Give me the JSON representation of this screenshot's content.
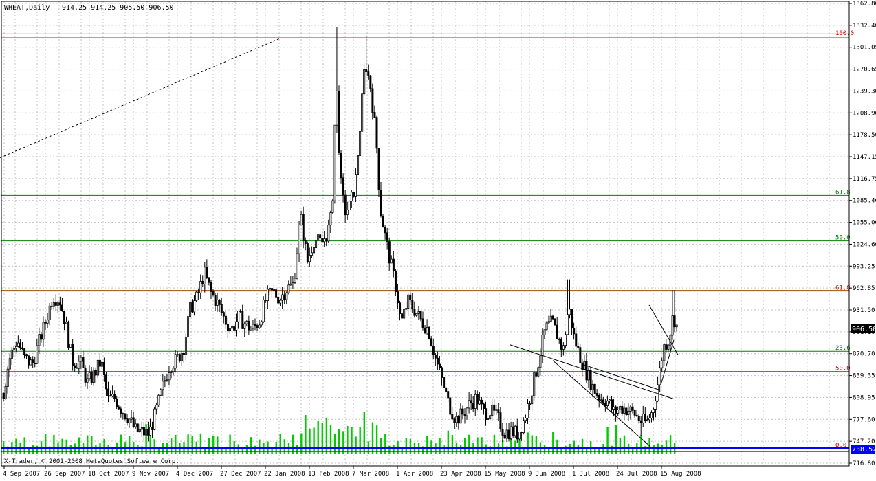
{
  "header": {
    "symbol": "WHEAT,Daily",
    "ohlc": "914.25 914.25 905.50 906.50"
  },
  "footer": {
    "copyright": "X-Trader, © 2001-2008 MetaQuotes Software Corp."
  },
  "colors": {
    "background": "#ffffff",
    "grid": "#c0c0c0",
    "candle": "#000000",
    "volume": "#00cc00",
    "fib_green": "#008000",
    "fib_red": "#d00000",
    "resistance_brown": "#a05000",
    "support_blue": "#0000ff",
    "current_price_bg": "#000000",
    "current_price_fg": "#ffffff",
    "support_label_bg": "#0000ff"
  },
  "chart_data": {
    "type": "candlestick",
    "ylim": [
      716.8,
      1362.8
    ],
    "price_ticks": [
      "1362.80",
      "1332.40",
      "1301.05",
      "1270.65",
      "1239.30",
      "1208.90",
      "1178.50",
      "1147.15",
      "1116.75",
      "1085.40",
      "1055.00",
      "1024.60",
      "993.25",
      "962.85",
      "931.50",
      "901.10",
      "870.70",
      "839.35",
      "808.95",
      "777.60",
      "747.20",
      "716.80"
    ],
    "date_ticks": [
      "4 Sep 2007",
      "26 Sep 2007",
      "18 Oct 2007",
      "9 Nov 2007",
      "4 Dec 2007",
      "27 Dec 2007",
      "22 Jan 2008",
      "13 Feb 2008",
      "7 Mar 2008",
      "1 Apr 2008",
      "23 Apr 2008",
      "15 May 2008",
      "9 Jun 2008",
      "1 Jul 2008",
      "24 Jul 2008",
      "15 Aug 2008"
    ],
    "current_price": "906.50",
    "current_price_value": 906.5,
    "support_price": "738.52",
    "support_price_value": 738.52,
    "fib_levels": [
      {
        "label": "100.0",
        "price": 1316.5,
        "color": "red"
      },
      {
        "label": "61.8",
        "price": 1093.0,
        "color": "green"
      },
      {
        "label": "50.0",
        "price": 1029.0,
        "color": "green"
      },
      {
        "label": "61.8",
        "price": 958.5,
        "color": "red"
      },
      {
        "label": "23.6",
        "price": 874.0,
        "color": "green"
      },
      {
        "label": "50.0",
        "price": 845.5,
        "color": "red"
      },
      {
        "label": "0.0",
        "price": 737.5,
        "color": "red"
      }
    ],
    "horizontal_lines": [
      {
        "name": "top-red",
        "price": 1320.0,
        "color": "red"
      },
      {
        "name": "top-green",
        "price": 1314.5,
        "color": "green"
      },
      {
        "name": "resistance",
        "price": 959.0,
        "color": "brown"
      },
      {
        "name": "support",
        "price": 738.5,
        "color": "blue"
      },
      {
        "name": "bottom-red",
        "price": 733.0,
        "color": "red"
      }
    ],
    "trend_lines": [
      {
        "name": "dotted-trend",
        "style": "dashed",
        "points": [
          [
            0,
            1146
          ],
          [
            408,
            1314
          ]
        ]
      },
      {
        "name": "upper-wedge",
        "style": "solid",
        "points": [
          [
            742,
            883
          ],
          [
            980,
            807
          ]
        ]
      },
      {
        "name": "lower-wedge",
        "style": "solid",
        "points": [
          [
            804,
            861
          ],
          [
            946,
            740
          ]
        ]
      },
      {
        "name": "inner-wedge",
        "style": "solid",
        "points": [
          [
            846,
            856
          ],
          [
            958,
            820
          ]
        ]
      },
      {
        "name": "breakout-line",
        "style": "solid",
        "points": [
          [
            944,
            939
          ],
          [
            986,
            869
          ]
        ]
      },
      {
        "name": "pullback-line",
        "style": "solid",
        "points": [
          [
            962,
            830
          ],
          [
            980,
            890
          ]
        ]
      }
    ],
    "price_path": [
      [
        4,
        815
      ],
      [
        12,
        862
      ],
      [
        24,
        890
      ],
      [
        34,
        865
      ],
      [
        46,
        855
      ],
      [
        56,
        888
      ],
      [
        64,
        912
      ],
      [
        76,
        952
      ],
      [
        86,
        946
      ],
      [
        94,
        915
      ],
      [
        104,
        860
      ],
      [
        116,
        858
      ],
      [
        126,
        830
      ],
      [
        136,
        842
      ],
      [
        146,
        860
      ],
      [
        156,
        806
      ],
      [
        166,
        808
      ],
      [
        176,
        792
      ],
      [
        186,
        780
      ],
      [
        196,
        763
      ],
      [
        206,
        760
      ],
      [
        216,
        758
      ],
      [
        226,
        790
      ],
      [
        236,
        825
      ],
      [
        246,
        855
      ],
      [
        256,
        862
      ],
      [
        266,
        878
      ],
      [
        276,
        935
      ],
      [
        286,
        950
      ],
      [
        296,
        985
      ],
      [
        306,
        956
      ],
      [
        316,
        940
      ],
      [
        326,
        918
      ],
      [
        336,
        905
      ],
      [
        346,
        922
      ],
      [
        356,
        912
      ],
      [
        366,
        905
      ],
      [
        376,
        916
      ],
      [
        386,
        948
      ],
      [
        396,
        958
      ],
      [
        406,
        948
      ],
      [
        416,
        962
      ],
      [
        426,
        968
      ],
      [
        436,
        1065
      ],
      [
        446,
        1000
      ],
      [
        456,
        1032
      ],
      [
        466,
        1025
      ],
      [
        476,
        1042
      ],
      [
        482,
        1068
      ],
      [
        488,
        1258
      ],
      [
        494,
        1115
      ],
      [
        500,
        1070
      ],
      [
        508,
        1078
      ],
      [
        516,
        1112
      ],
      [
        522,
        1182
      ],
      [
        530,
        1282
      ],
      [
        538,
        1245
      ],
      [
        546,
        1175
      ],
      [
        552,
        1075
      ],
      [
        558,
        1042
      ],
      [
        564,
        1012
      ],
      [
        570,
        985
      ],
      [
        576,
        958
      ],
      [
        582,
        912
      ],
      [
        592,
        945
      ],
      [
        602,
        932
      ],
      [
        612,
        916
      ],
      [
        622,
        905
      ],
      [
        632,
        865
      ],
      [
        642,
        832
      ],
      [
        652,
        798
      ],
      [
        662,
        778
      ],
      [
        672,
        786
      ],
      [
        682,
        800
      ],
      [
        692,
        808
      ],
      [
        702,
        788
      ],
      [
        712,
        790
      ],
      [
        722,
        782
      ],
      [
        732,
        760
      ],
      [
        742,
        762
      ],
      [
        752,
        758
      ],
      [
        762,
        780
      ],
      [
        772,
        818
      ],
      [
        782,
        860
      ],
      [
        792,
        905
      ],
      [
        802,
        915
      ],
      [
        810,
        895
      ],
      [
        818,
        875
      ],
      [
        826,
        938
      ],
      [
        834,
        892
      ],
      [
        842,
        868
      ],
      [
        852,
        844
      ],
      [
        862,
        822
      ],
      [
        872,
        808
      ],
      [
        882,
        805
      ],
      [
        892,
        788
      ],
      [
        902,
        795
      ],
      [
        912,
        792
      ],
      [
        922,
        786
      ],
      [
        932,
        775
      ],
      [
        940,
        775
      ],
      [
        948,
        790
      ],
      [
        956,
        830
      ],
      [
        964,
        880
      ],
      [
        972,
        892
      ],
      [
        978,
        925
      ],
      [
        984,
        906
      ]
    ],
    "volume_bars": 160
  }
}
